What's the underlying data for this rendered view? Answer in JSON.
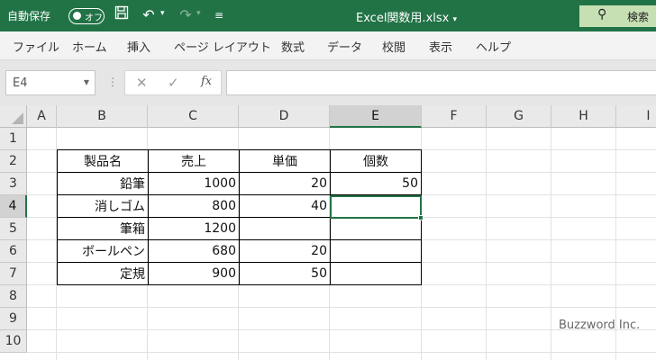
{
  "titlebar": {
    "autosave_label": "自動保存",
    "toggle_label": "オフ",
    "file_title": "Excel関数用.xlsx",
    "search_label": "検索"
  },
  "ribbon": {
    "tabs": [
      "ファイル",
      "ホーム",
      "挿入",
      "ページ レイアウト",
      "数式",
      "データ",
      "校閲",
      "表示",
      "ヘルプ"
    ]
  },
  "formula_bar": {
    "name_box": "E4",
    "fx_label": "fx",
    "formula": ""
  },
  "sheet": {
    "columns": [
      "A",
      "B",
      "C",
      "D",
      "E",
      "F",
      "G",
      "H",
      "I"
    ],
    "selected_column": "E",
    "rows": [
      "1",
      "2",
      "3",
      "4",
      "5",
      "6",
      "7",
      "8",
      "9",
      "10"
    ],
    "selected_row": "4",
    "table_header": [
      "製品名",
      "売上",
      "単価",
      "個数"
    ],
    "table_rows": [
      [
        "鉛筆",
        "1000",
        "20",
        "50"
      ],
      [
        "消しゴム",
        "800",
        "40",
        ""
      ],
      [
        "筆箱",
        "1200",
        "",
        ""
      ],
      [
        "ボールペン",
        "680",
        "20",
        ""
      ],
      [
        "定規",
        "900",
        "50",
        ""
      ]
    ]
  },
  "watermark": "Buzzword Inc.",
  "colors": {
    "excel_green": "#217346",
    "search_bg": "#c6e0b4"
  }
}
